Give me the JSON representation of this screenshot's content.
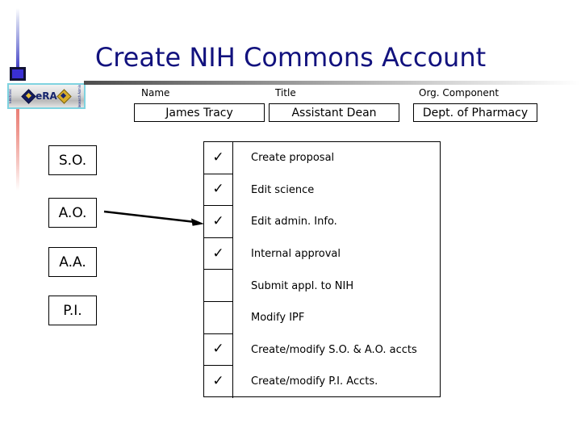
{
  "slide": {
    "title": "Create NIH Commons Account"
  },
  "logo": {
    "word": "eRA",
    "left_text": "Electronic",
    "right_text": "Research Admin.",
    "left_diamond_icon": "diamond-icon",
    "right_diamond_icon": "diamond-icon"
  },
  "header_fields": [
    {
      "label": "Name",
      "value": "James Tracy"
    },
    {
      "label": "Title",
      "value": "Assistant Dean"
    },
    {
      "label": "Org. Component",
      "value": "Dept. of Pharmacy"
    }
  ],
  "roles": [
    {
      "label": "S.O."
    },
    {
      "label": "A.O."
    },
    {
      "label": "A.A."
    },
    {
      "label": "P.I."
    }
  ],
  "connector": {
    "from_role": "A.O.",
    "arrow_icon": "arrow-right-icon"
  },
  "tasks": [
    {
      "label": "Create proposal",
      "checked": true,
      "check": "✓"
    },
    {
      "label": "Edit science",
      "checked": true,
      "check": "✓"
    },
    {
      "label": "Edit admin. Info.",
      "checked": true,
      "check": "✓"
    },
    {
      "label": "Internal approval",
      "checked": true,
      "check": "✓"
    },
    {
      "label": "Submit appl. to NIH",
      "checked": false,
      "check": ""
    },
    {
      "label": "Modify IPF",
      "checked": false,
      "check": ""
    },
    {
      "label": "Create/modify S.O. & A.O. accts",
      "checked": true,
      "check": "✓"
    },
    {
      "label": "Create/modify  P.I. Accts.",
      "checked": true,
      "check": "✓"
    }
  ],
  "colors": {
    "title": "#12127e",
    "text": "#000000",
    "rail_blue": "#3b37c4",
    "rail_red": "#e8776f",
    "logo_border": "#7fd3e0"
  }
}
